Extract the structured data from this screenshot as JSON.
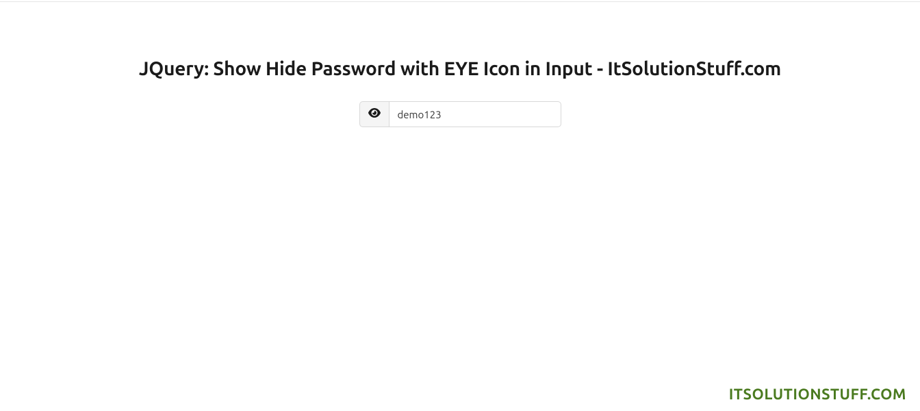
{
  "page": {
    "title": "JQuery: Show Hide Password with EYE Icon in Input - ItSolutionStuff.com"
  },
  "form": {
    "password_value": "demo123"
  },
  "footer": {
    "watermark": "ITSOLUTIONSTUFF.COM"
  }
}
